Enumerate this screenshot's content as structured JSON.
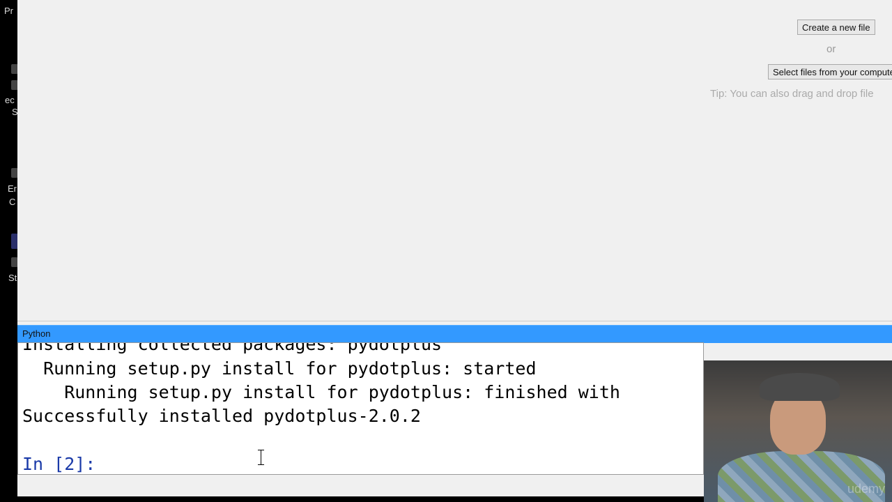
{
  "desktop": {
    "labels": [
      "Pr",
      "ec",
      "S",
      "Er",
      "C",
      "St"
    ]
  },
  "upload": {
    "create_button": "Create a new file",
    "or_text": "or",
    "select_button": "Select files from your compute",
    "tip": "Tip: You can also drag and drop file"
  },
  "console": {
    "title": "Python",
    "lines": [
      "Installing collected packages: pydotplus",
      "  Running setup.py install for pydotplus: started",
      "    Running setup.py install for pydotplus: finished with",
      "Successfully installed pydotplus-2.0.2"
    ],
    "prompt": "In [2]:"
  },
  "webcam": {
    "watermark": "udemy"
  },
  "colors": {
    "title_bar": "#3399ff",
    "prompt": "#1a3aa8"
  }
}
